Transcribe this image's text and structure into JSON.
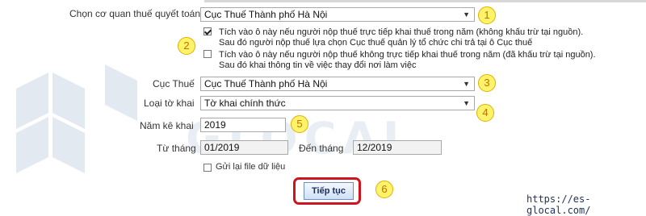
{
  "form": {
    "tax_authority_label": "Chọn cơ quan thuế quyết toán",
    "tax_authority_value": "Cục Thuế Thành phố Hà Nội",
    "option_direct_line1": "Tích vào ô này nếu người nộp thuế trực tiếp khai thuế trong năm (không khấu trừ tại nguồn).",
    "option_direct_line2": "Sau đó người nộp thuế lựa chọn Cục thuế quản lý tổ chức chi trả tại ô Cục thuế",
    "option_direct_checked": true,
    "option_withheld_line1": "Tích vào ô này nếu người nộp thuế không trực tiếp khai thuế trong năm (đã khấu trừ tại nguồn).",
    "option_withheld_line2": "Sau đó khai thông tin về việc thay đổi nơi làm việc",
    "option_withheld_checked": false,
    "department_label": "Cục Thuế",
    "department_value": "Cục Thuế Thành phố Hà Nội",
    "declaration_type_label": "Loại tờ khai",
    "declaration_type_value": "Tờ khai chính thức",
    "year_label": "Năm kê khai",
    "year_value": "2019",
    "from_month_label": "Từ tháng",
    "from_month_value": "01/2019",
    "to_month_label": "Đến tháng",
    "to_month_value": "12/2019",
    "resend_label": "Gửi lại file dữ liệu",
    "resend_checked": false,
    "submit_label": "Tiếp tục"
  },
  "annotations": [
    "1",
    "2",
    "3",
    "4",
    "5",
    "6"
  ],
  "watermark": {
    "text": "GLOCAL",
    "color": "#dfe6ee"
  },
  "footer": {
    "url": "https://es-glocal.com/"
  },
  "colors": {
    "badge_fill": "#fff36a",
    "badge_text": "#c07000",
    "highlight_frame": "#d0141e"
  }
}
